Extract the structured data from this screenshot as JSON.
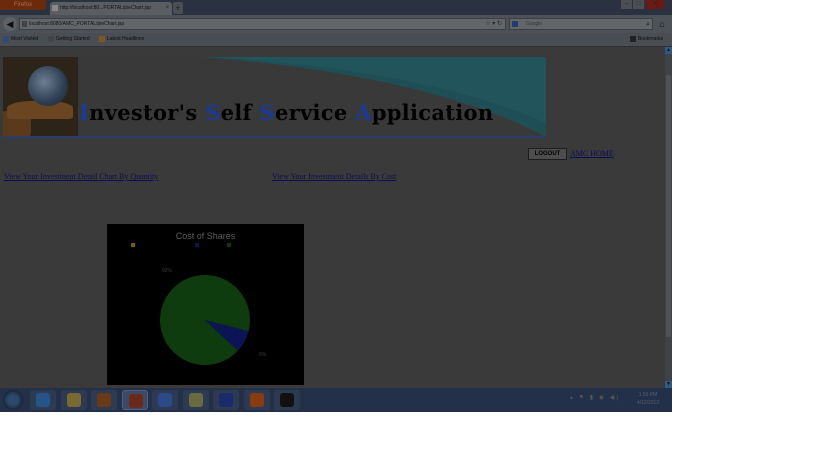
{
  "browser": {
    "menu_button": "Firefox",
    "tab_title": "http://localhost:80...PORTAL/pieChart.jsp",
    "new_tab": "+",
    "url": "localhost:8080/AMC_PORTAL/pieChart.jsp",
    "search_placeholder": "Google",
    "bookmarks": [
      "Most Visited",
      "Getting Started",
      "Latest Headlines"
    ],
    "bookmarks_menu": "Bookmarks"
  },
  "page": {
    "title_parts": [
      {
        "cap": "I",
        "rest": "nvestor's "
      },
      {
        "cap": "S",
        "rest": "elf "
      },
      {
        "cap": "S",
        "rest": "ervice "
      },
      {
        "cap": "A",
        "rest": "pplication"
      }
    ],
    "logout_label": "LOGOUT",
    "amc_home_label": "AMC HOME",
    "link_quantity": "View Your Investment Detail Chart By Quantity",
    "link_cost": "View Your Investment Details By Cost"
  },
  "chart_data": {
    "type": "pie",
    "title": "Cost of Shares",
    "slices": [
      {
        "label": "",
        "value": 0.92,
        "color": "#0e3c0e"
      },
      {
        "label": "",
        "value": 0.08,
        "color": "#0b1555"
      }
    ],
    "data_labels": [
      "92%",
      "8%"
    ],
    "legend": [
      "",
      "",
      ""
    ],
    "legend_colors": [
      "#7a5a10",
      "#0b1555",
      "#0e3c0e"
    ],
    "legend_placement": "top"
  },
  "taskbar": {
    "time": "1:56 PM",
    "date": "4/12/2013",
    "apps": [
      {
        "name": "ie",
        "color": "#23558a"
      },
      {
        "name": "explorer",
        "color": "#7a6a30"
      },
      {
        "name": "media-player",
        "color": "#6a3a18"
      },
      {
        "name": "firefox",
        "color": "#6a2a1a"
      },
      {
        "name": "app5",
        "color": "#2a4a8a"
      },
      {
        "name": "app6",
        "color": "#6a6a40"
      },
      {
        "name": "app7",
        "color": "#1a2a6a"
      },
      {
        "name": "app8",
        "color": "#8a3a10"
      },
      {
        "name": "app9",
        "color": "#111111"
      }
    ]
  }
}
